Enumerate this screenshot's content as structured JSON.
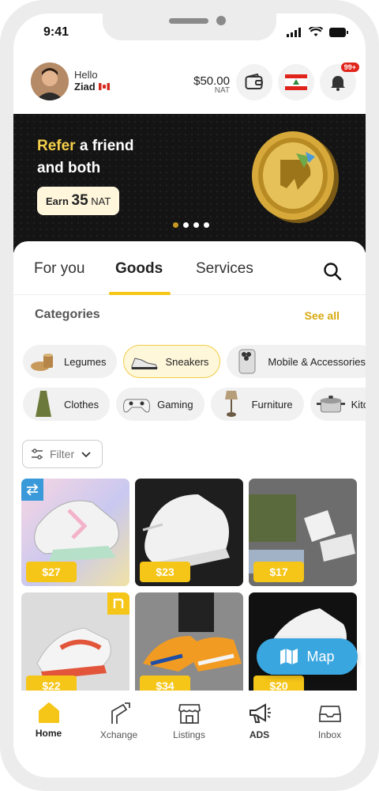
{
  "status_bar": {
    "time": "9:41"
  },
  "header": {
    "greeting": "Hello",
    "user_name": "Ziad",
    "balance": "$50.00",
    "balance_unit": "NAT",
    "notification_count": "99+"
  },
  "banner": {
    "title_highlight": "Refer",
    "title_rest_line1": " a friend",
    "title_line2": "and both",
    "earn_label": "Earn",
    "earn_amount": "35",
    "earn_unit": "NAT",
    "slide_count": 4,
    "active_slide": 1
  },
  "tabs": [
    {
      "label": "For you",
      "active": false
    },
    {
      "label": "Goods",
      "active": true
    },
    {
      "label": "Services",
      "active": false
    }
  ],
  "categories": {
    "title": "Categories",
    "see_all": "See all",
    "row1": [
      {
        "label": "Legumes",
        "icon": "legumes-icon",
        "selected": false
      },
      {
        "label": "Sneakers",
        "icon": "sneaker-icon",
        "selected": true
      },
      {
        "label": "Mobile & Accessories",
        "icon": "phone-icon",
        "selected": false
      }
    ],
    "row2": [
      {
        "label": "Clothes",
        "icon": "dress-icon",
        "selected": false
      },
      {
        "label": "Gaming",
        "icon": "gamepad-icon",
        "selected": false
      },
      {
        "label": "Furniture",
        "icon": "lamp-icon",
        "selected": false
      },
      {
        "label": "Kitchen",
        "icon": "pot-icon",
        "selected": false
      }
    ]
  },
  "filter": {
    "label": "Filter"
  },
  "products": [
    {
      "price": "$27",
      "badge": "exchange-icon"
    },
    {
      "price": "$23",
      "badge": ""
    },
    {
      "price": "$17",
      "badge": ""
    },
    {
      "price": "$22",
      "badge": "brand-icon"
    },
    {
      "price": "$34",
      "badge": ""
    },
    {
      "price": "$20",
      "badge": ""
    }
  ],
  "map_button": {
    "label": "Map"
  },
  "bottom_nav": [
    {
      "label": "Home",
      "icon": "home-icon",
      "active": true
    },
    {
      "label": "Xchange",
      "icon": "xchange-icon",
      "active": false
    },
    {
      "label": "Listings",
      "icon": "store-icon",
      "active": false
    },
    {
      "label": "ADS",
      "icon": "megaphone-icon",
      "active": false
    },
    {
      "label": "Inbox",
      "icon": "inbox-icon",
      "active": false
    }
  ],
  "colors": {
    "accent": "#f5c518",
    "map": "#3aa6df",
    "banner_bg": "#141414",
    "badge_red": "#e0241b"
  }
}
